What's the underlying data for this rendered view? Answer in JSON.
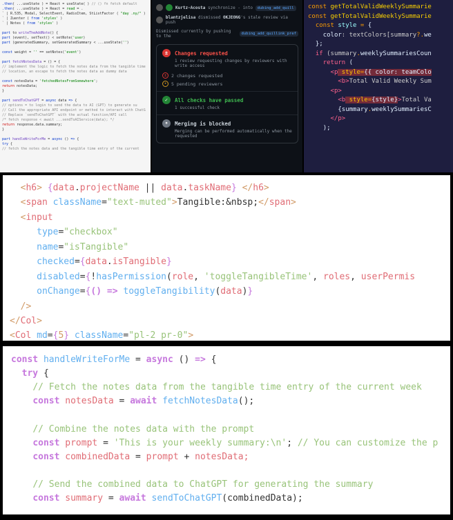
{
  "panel1": {
    "lines": [
      ".then( ...useState ) = React = useState( ) // () fn fetch default",
      ".then( ...useState ) = React = read = .",
      "` | R.535, Modal, SelectEvent, RadioItem, StListFactor ( \"day .ny/\" )",
      "` | Zuenter ( from 'styles' )",
      "` | Notes ( from 'styles' )",
      "",
      "part to writeTheAddNote() {",
      "part (event), setText() < setNote('user)",
      "part (generatedSummary, setGeneratedSummary < ...useState('')",
      "",
      "const weight = '' == setNotes('event')",
      "",
      "part fetchNotesData = () = {",
      "  // implement the logic to fetch the notes data from the tangible",
      "  // location, an escape to fetch the notes data as dummy data",
      "",
      "  const notesData = 'fetchedNotesFromSomewhere';",
      "  return notesData;",
      "}",
      "",
      "part sendToChatGPT = async data => {",
      "  // options = to login to send the data to AI (GPT) to generate su",
      "  // Call the appropriate API endpoint or method to interact with ChatG",
      "  // Replace `sendToChatGPT` with the actual function/API call",
      "  /* fetch response < await ...sendToAIService(data); */",
      "  return response.data.summary;",
      "}",
      "",
      "part handleWriteForMe = async () => {",
      "  try {",
      "  // fetch the notes data and the tangible time entry of the current"
    ]
  },
  "panel2": {
    "header1_user": "Kurtz-Acosta",
    "header1_action": "synchronize",
    "header1_branch": "dubing_add_quill",
    "header2_user": "blantzjelisa",
    "header2_action": "dismissed",
    "header2_target": "OKJEONG",
    "header2_rest": "'s stale review via push",
    "header3": "Dismissed currently by pushing to the",
    "header3_branch": "dubing_add_quillink_pref",
    "checks": [
      {
        "icon": "red-bg",
        "title": "Changes requested",
        "title_class": "red-text",
        "sub": "1 review requesting changes by reviewers with write access",
        "sublines": [
          {
            "icon": "red-outline",
            "text": "2 changes requested"
          },
          {
            "icon": "yellow-outline",
            "text": "5 pending reviewers"
          }
        ]
      },
      {
        "icon": "green-bg",
        "title": "All checks have passed",
        "title_class": "green-text",
        "sub": "1 successful check"
      },
      {
        "icon": "gray-bg",
        "title": "Merging is blocked",
        "title_class": "",
        "sub": "Merging can be performed automatically when the requested"
      }
    ]
  },
  "panel3": {
    "l1a": "const",
    "l1b": " getTotalValidWeeklySummarie",
    "l2a": "const",
    "l2b": " getTotalValidWeeklySummarie",
    "l3a": "const",
    "l3b": " style ",
    "l3c": "=",
    "l3d": " {",
    "l4a": "color",
    "l4b": ": textColors[summary",
    "l4c": "?.",
    "l4d": "we",
    "l5": "};",
    "l6a": "if",
    "l6b": " (summary",
    "l6c": ".",
    "l6d": "weeklySummariesCoun",
    "l7a": "return",
    "l7b": " (",
    "l8a": "<",
    "l8b": "p",
    "l8c": " style",
    "l8d": "=",
    "l8e": "{{ color: teamColo",
    "l9a": "<",
    "l9b": "b",
    "l9c": ">",
    "l9d": "Total Valid Weekly Sum",
    "l10a": "<",
    "l10b": "p",
    "l10c": ">",
    "l11a": "<",
    "l11b": "b",
    "l11c": " style",
    "l11d": "=",
    "l11e": "{style}",
    "l11f": ">",
    "l11g": "Total Va",
    "l12a": "{summary",
    "l12b": ".",
    "l12c": "weeklySummariesC",
    "l13a": "</",
    "l13b": "p",
    "l13c": ">",
    "l14": ");"
  },
  "middle": {
    "l1a": "<",
    "l1b": "h6",
    "l1c": "> ",
    "l1d": "{",
    "l1e": "data",
    "l1f": ".",
    "l1g": "projectName",
    "l1h": " || ",
    "l1i": "data",
    "l1j": ".",
    "l1k": "taskName",
    "l1l": "}",
    "l1m": " </",
    "l1n": "h6",
    "l1o": ">",
    "l2a": "<",
    "l2b": "span",
    "l2c": " className",
    "l2d": "=",
    "l2e": "\"text-muted\"",
    "l2f": ">",
    "l2g": "Tangible:&nbsp;",
    "l2h": "</",
    "l2i": "span",
    "l2j": ">",
    "l3a": "<",
    "l3b": "input",
    "l4a": "type",
    "l4b": "=",
    "l4c": "\"checkbox\"",
    "l5a": "name",
    "l5b": "=",
    "l5c": "\"isTangible\"",
    "l6a": "checked",
    "l6b": "=",
    "l6c": "{",
    "l6d": "data",
    "l6e": ".",
    "l6f": "isTangible",
    "l6g": "}",
    "l7a": "disabled",
    "l7b": "=",
    "l7c": "{",
    "l7d": "!",
    "l7e": "hasPermission",
    "l7f": "(",
    "l7g": "role",
    "l7h": ", ",
    "l7i": "'toggleTangibleTime'",
    "l7j": ", ",
    "l7k": "roles",
    "l7l": ", ",
    "l7m": "userPermis",
    "l8a": "onChange",
    "l8b": "=",
    "l8c": "{",
    "l8d": "()",
    "l8e": " => ",
    "l8f": "toggleTangibility",
    "l8g": "(",
    "l8h": "data",
    "l8i": ")",
    "l8j": "}",
    "l9": "/>",
    "l10a": "</",
    "l10b": "Col",
    "l10c": ">",
    "l11a": "<",
    "l11b": "Col",
    "l11c": " md",
    "l11d": "=",
    "l11e": "{",
    "l11f": "5",
    "l11g": "}",
    "l11h": " className",
    "l11i": "=",
    "l11j": "\"pl-2 pr-0\"",
    "l11k": ">"
  },
  "bottom": {
    "l1a": "const",
    "l1b": " handleWriteForMe ",
    "l1c": "=",
    "l1d": " async ",
    "l1e": "()",
    "l1f": " => ",
    "l1g": "{",
    "l2a": "try",
    "l2b": " {",
    "l3": "// Fetch the notes data from the tangible time entry of the current week",
    "l4a": "const",
    "l4b": " notesData ",
    "l4c": "=",
    "l4d": " await ",
    "l4e": "fetchNotesData",
    "l4f": "();",
    "l5": "",
    "l6": "// Combine the notes data with the prompt",
    "l7a": "const",
    "l7b": " prompt ",
    "l7c": "=",
    "l7d": " 'This is your weekly summary:\\n'",
    "l7e": "; ",
    "l7f": "// You can customize the p",
    "l8a": "const",
    "l8b": " combinedData ",
    "l8c": "=",
    "l8d": " prompt ",
    "l8e": "+",
    "l8f": " notesData;",
    "l9": "",
    "l10": "// Send the combined data to ChatGPT for generating the summary",
    "l11a": "const",
    "l11b": " summary ",
    "l11c": "=",
    "l11d": " await ",
    "l11e": "sendToChatGPT",
    "l11f": "(combinedData);"
  }
}
